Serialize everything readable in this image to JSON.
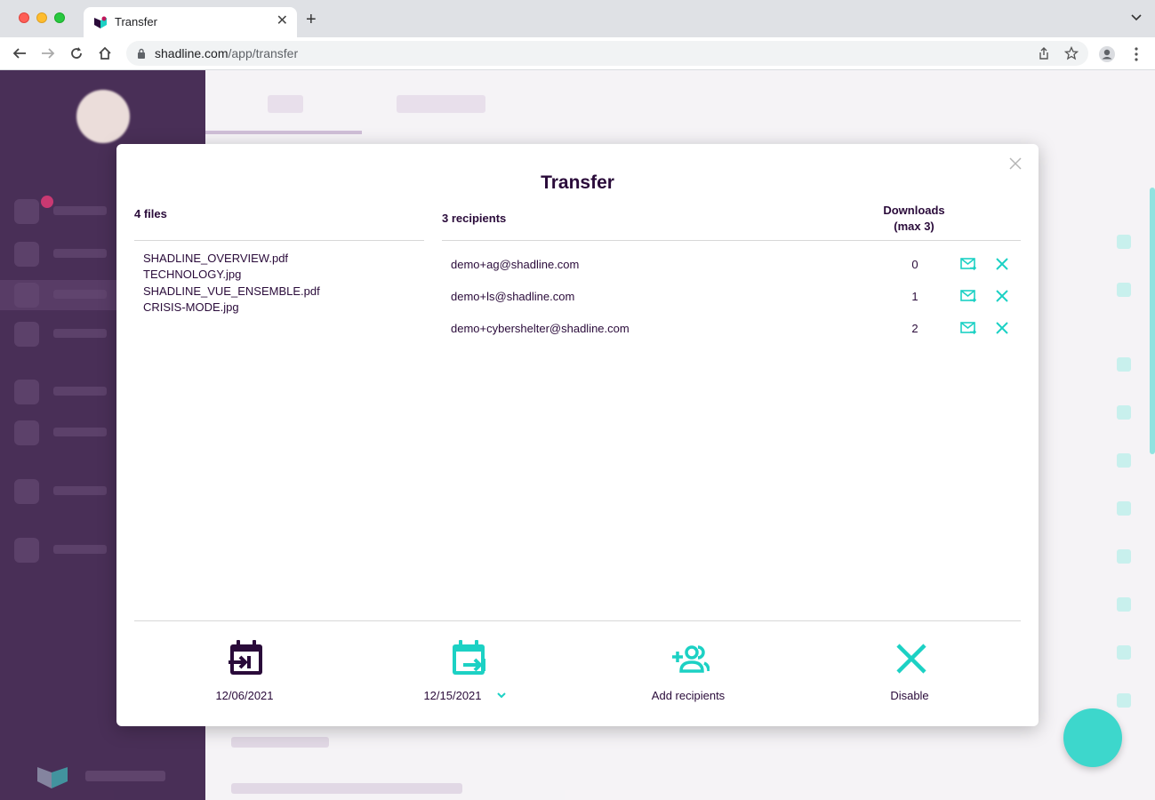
{
  "browser": {
    "tab_title": "Transfer",
    "url_host": "shadline.com",
    "url_path": "/app/transfer"
  },
  "modal": {
    "title": "Transfer",
    "files_header": "4 files",
    "files": [
      "SHADLINE_OVERVIEW.pdf",
      "TECHNOLOGY.jpg",
      "SHADLINE_VUE_ENSEMBLE.pdf",
      "CRISIS-MODE.jpg"
    ],
    "recipients_header": "3 recipients",
    "downloads_header": "Downloads (max 3)",
    "recipients": [
      {
        "email": "demo+ag@shadline.com",
        "downloads": "0"
      },
      {
        "email": "demo+ls@shadline.com",
        "downloads": "1"
      },
      {
        "email": "demo+cybershelter@shadline.com",
        "downloads": "2"
      }
    ],
    "actions": {
      "start_date": "12/06/2021",
      "end_date": "12/15/2021",
      "add_recipients": "Add recipients",
      "disable": "Disable"
    }
  },
  "colors": {
    "brand_purple": "#2a0b3a",
    "accent_teal": "#1cd1c4"
  }
}
